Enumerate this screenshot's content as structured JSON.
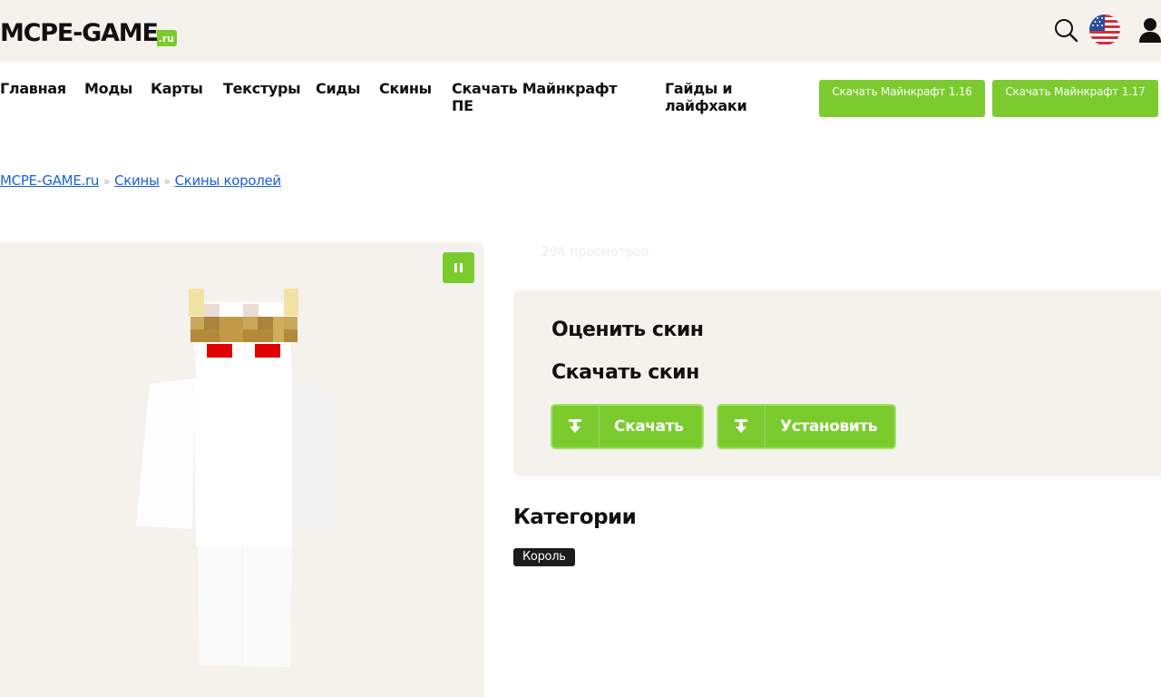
{
  "header": {
    "logo_main": "MCPE-GAME",
    "logo_suffix": ".ru",
    "icons": [
      "search-icon",
      "us-flag-icon",
      "user-icon"
    ]
  },
  "nav": {
    "items": [
      "Главная",
      "Моды",
      "Карты",
      "Текстуры",
      "Сиды",
      "Скины",
      "Скачать Майнкрафт ПЕ",
      "Гайды и лайфхаки"
    ],
    "buttons": [
      "Скачать Майнкрафт 1.16",
      "Скачать Майнкрафт 1.17"
    ]
  },
  "breadcrumb": {
    "items": [
      "MCPE-GAME.ru",
      "Скины",
      "Скины королей"
    ],
    "separator": "»"
  },
  "skin": {
    "views": "294 просмотров",
    "description": "white minecraft skin with golden crown and red eyes"
  },
  "actions": {
    "rate_title": "Оценить скин",
    "download_title": "Скачать скин",
    "download_button": "Скачать",
    "install_button": "Установить"
  },
  "categories": {
    "title": "Категории",
    "tags": [
      "Король"
    ]
  },
  "colors": {
    "accent_green": "#7bcb2f",
    "panel_bg": "#f5f2ed",
    "link_blue": "#1a62d6",
    "tag_bg": "#1c1c1c"
  }
}
